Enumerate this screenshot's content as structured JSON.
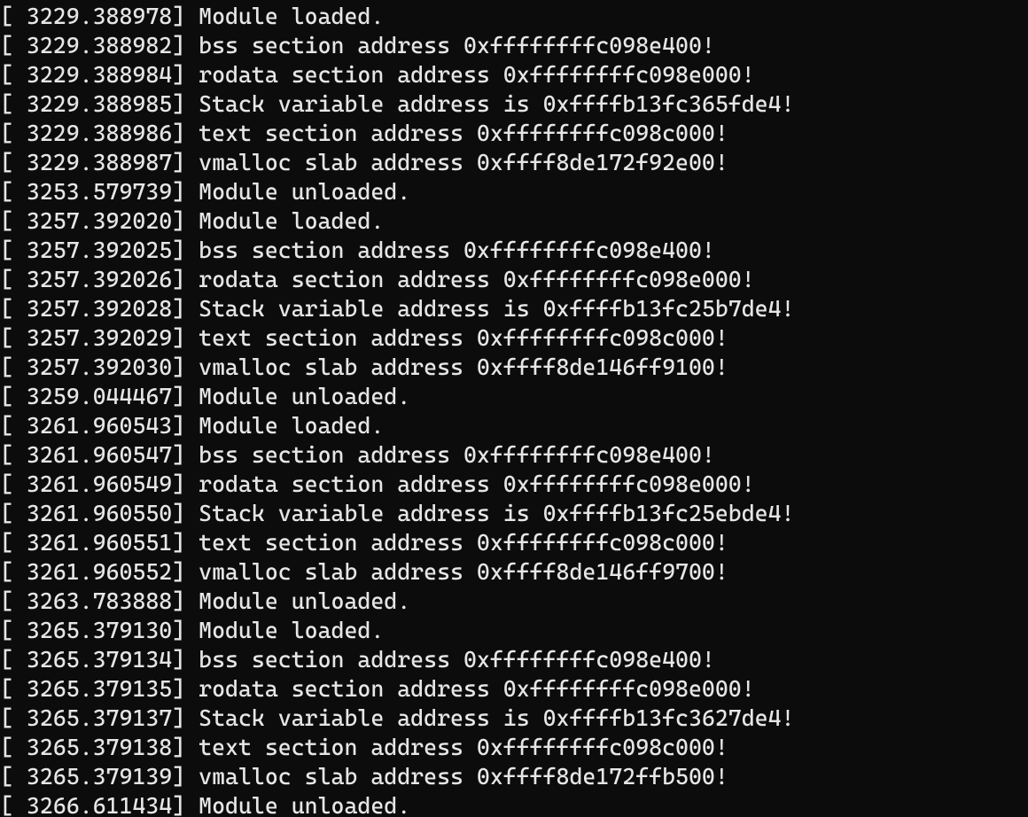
{
  "log": {
    "lines": [
      {
        "timestamp": "3229.388978",
        "message": "Module loaded."
      },
      {
        "timestamp": "3229.388982",
        "message": "bss section address 0xffffffffc098e400!"
      },
      {
        "timestamp": "3229.388984",
        "message": "rodata section address 0xffffffffc098e000!"
      },
      {
        "timestamp": "3229.388985",
        "message": "Stack variable address is 0xffffb13fc365fde4!"
      },
      {
        "timestamp": "3229.388986",
        "message": "text section address 0xffffffffc098c000!"
      },
      {
        "timestamp": "3229.388987",
        "message": "vmalloc slab address 0xffff8de172f92e00!"
      },
      {
        "timestamp": "3253.579739",
        "message": "Module unloaded."
      },
      {
        "timestamp": "3257.392020",
        "message": "Module loaded."
      },
      {
        "timestamp": "3257.392025",
        "message": "bss section address 0xffffffffc098e400!"
      },
      {
        "timestamp": "3257.392026",
        "message": "rodata section address 0xffffffffc098e000!"
      },
      {
        "timestamp": "3257.392028",
        "message": "Stack variable address is 0xffffb13fc25b7de4!"
      },
      {
        "timestamp": "3257.392029",
        "message": "text section address 0xffffffffc098c000!"
      },
      {
        "timestamp": "3257.392030",
        "message": "vmalloc slab address 0xffff8de146ff9100!"
      },
      {
        "timestamp": "3259.044467",
        "message": "Module unloaded."
      },
      {
        "timestamp": "3261.960543",
        "message": "Module loaded."
      },
      {
        "timestamp": "3261.960547",
        "message": "bss section address 0xffffffffc098e400!"
      },
      {
        "timestamp": "3261.960549",
        "message": "rodata section address 0xffffffffc098e000!"
      },
      {
        "timestamp": "3261.960550",
        "message": "Stack variable address is 0xffffb13fc25ebde4!"
      },
      {
        "timestamp": "3261.960551",
        "message": "text section address 0xffffffffc098c000!"
      },
      {
        "timestamp": "3261.960552",
        "message": "vmalloc slab address 0xffff8de146ff9700!"
      },
      {
        "timestamp": "3263.783888",
        "message": "Module unloaded."
      },
      {
        "timestamp": "3265.379130",
        "message": "Module loaded."
      },
      {
        "timestamp": "3265.379134",
        "message": "bss section address 0xffffffffc098e400!"
      },
      {
        "timestamp": "3265.379135",
        "message": "rodata section address 0xffffffffc098e000!"
      },
      {
        "timestamp": "3265.379137",
        "message": "Stack variable address is 0xffffb13fc3627de4!"
      },
      {
        "timestamp": "3265.379138",
        "message": "text section address 0xffffffffc098c000!"
      },
      {
        "timestamp": "3265.379139",
        "message": "vmalloc slab address 0xffff8de172ffb500!"
      },
      {
        "timestamp": "3266.611434",
        "message": "Module unloaded."
      }
    ]
  }
}
